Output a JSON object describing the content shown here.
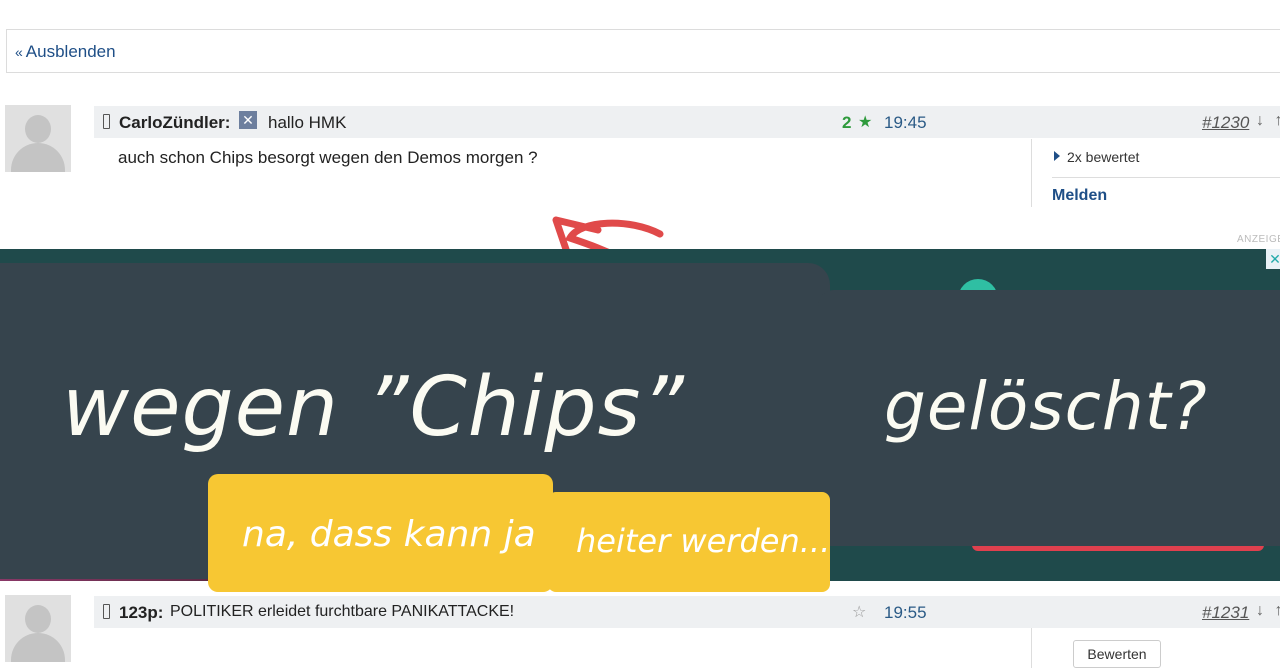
{
  "hide_link": "Ausblenden",
  "comments": [
    {
      "author": "CarloZündler:",
      "subject": "hallo HMK",
      "score": "2",
      "time": "19:45",
      "number": "#1230",
      "arrows": "↓ ↑",
      "text": "auch schon Chips besorgt wegen den Demos morgen ?",
      "rated": "2x bewertet",
      "report": "Melden"
    },
    {
      "author": "123p:",
      "subject": "POLITIKER erleidet furchtbare PANIKATTACKE!",
      "time": "19:55",
      "number": "#1231",
      "arrows": "↓ ↑",
      "rate_button": "Bewerten"
    }
  ],
  "ad_label": "ANZEIGE",
  "overlay": {
    "big_left": "wegen ”Chips”",
    "big_right": "gelöscht?",
    "yellow_left": "na, dass kann ja",
    "yellow_right": "heiter werden..."
  },
  "colors": {
    "link": "#1f4f87",
    "score": "#2e9a3c",
    "overlay_panel": "#36444d",
    "sticker": "#f7c733",
    "arrow": "#e04a4a"
  }
}
